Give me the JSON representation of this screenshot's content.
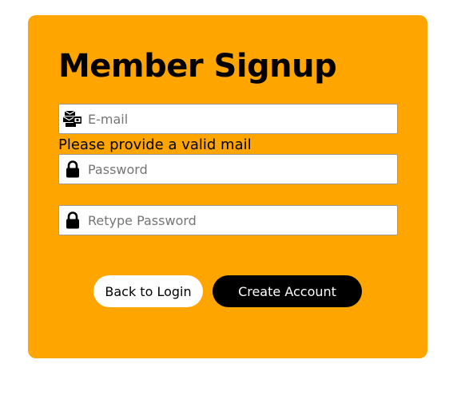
{
  "theme": {
    "card_background": "#FFA500",
    "primary_button_bg": "#000000",
    "secondary_button_bg": "#FFFFFF"
  },
  "form": {
    "title": "Member Signup",
    "email": {
      "placeholder": "E-mail",
      "value": "",
      "icon": "mail-icon",
      "error": "Please provide a valid mail"
    },
    "password": {
      "placeholder": "Password",
      "value": "",
      "icon": "lock-icon"
    },
    "retype_password": {
      "placeholder": "Retype Password",
      "value": "",
      "icon": "lock-icon"
    }
  },
  "actions": {
    "back_label": "Back to Login",
    "create_label": "Create Account"
  }
}
